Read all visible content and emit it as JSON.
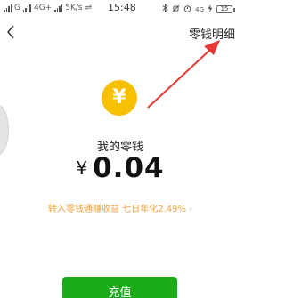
{
  "status_bar": {
    "left_text_1": "G",
    "left_text_2": "4G+",
    "speed": "5K/s",
    "extra": "⇌",
    "time": "15:48",
    "icons": [
      "bluetooth-icon",
      "mute-icon",
      "alarm-icon",
      "4g-icon",
      "charging-icon"
    ],
    "network_right": "4G",
    "battery": "15"
  },
  "header": {
    "back_icon": "chevron-left-icon",
    "detail_link": "零钱明细"
  },
  "wallet": {
    "coin_symbol": "¥",
    "label": "我的零钱",
    "currency": "¥",
    "amount": "0.04",
    "promo_text": "转入零钱通赚收益 七日年化2.49%",
    "promo_chevron": "›"
  },
  "actions": {
    "recharge": "充值"
  },
  "colors": {
    "accent_green": "#1aad19",
    "coin_yellow": "#f7c000",
    "promo_orange": "#f0a33b",
    "annotation_red": "#e53935"
  }
}
